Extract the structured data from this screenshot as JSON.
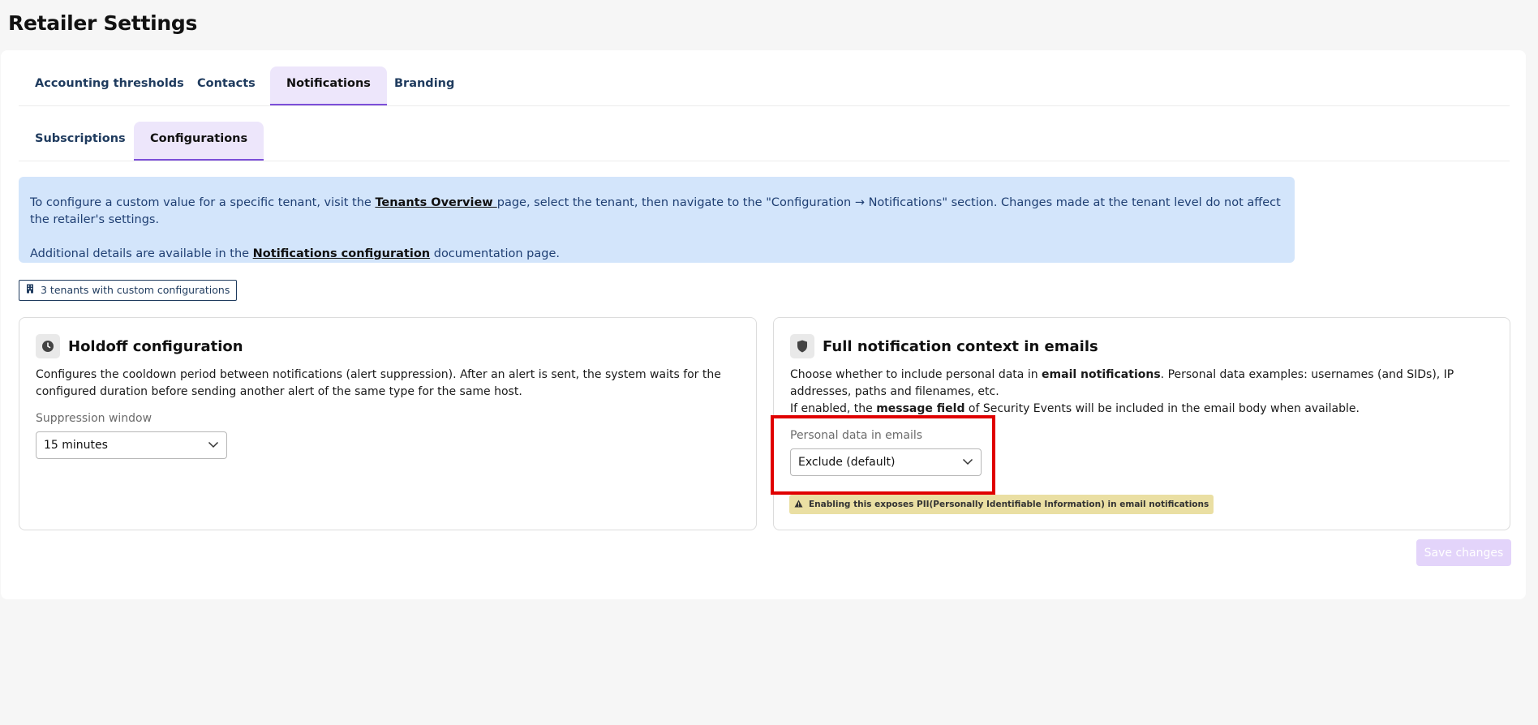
{
  "page": {
    "title": "Retailer Settings"
  },
  "main_tabs": [
    {
      "label": "Accounting thresholds",
      "active": false
    },
    {
      "label": "Contacts",
      "active": false
    },
    {
      "label": "Notifications",
      "active": true
    },
    {
      "label": "Branding",
      "active": false
    }
  ],
  "sub_tabs": [
    {
      "label": "Subscriptions",
      "active": false
    },
    {
      "label": "Configurations",
      "active": true
    }
  ],
  "info": {
    "line1_prefix": "To configure a custom value for a specific tenant, visit the ",
    "line1_link": "Tenants Overview ",
    "line1_suffix": " page, select the tenant, then navigate to the \"Configuration → Notifications\" section. Changes made at the tenant level do not affect the retailer's settings.",
    "line2_prefix": "Additional details are available in the ",
    "line2_link": "Notifications configuration",
    "line2_suffix": " documentation page."
  },
  "tenant_badge": {
    "icon": "building-icon",
    "label": "3 tenants with custom configurations"
  },
  "holdoff": {
    "icon": "clock-icon",
    "title": "Holdoff configuration",
    "description": "Configures the cooldown period between notifications (alert suppression). After an alert is sent, the system waits for the configured duration before sending another alert of the same type for the same host.",
    "field_label": "Suppression window",
    "selected": "15 minutes"
  },
  "full_context": {
    "icon": "shield-icon",
    "title": "Full notification context in emails",
    "desc_1": "Choose whether to include personal data in ",
    "desc_bold_1": "email notifications",
    "desc_2": ". Personal data examples: usernames (and SIDs), IP addresses, paths and filenames, etc.",
    "desc_3": "If enabled, the ",
    "desc_bold_2": "message field",
    "desc_4": " of Security Events will be included in the email body when available.",
    "field_label": "Personal data in emails",
    "selected": "Exclude (default)",
    "warning": "Enabling this exposes PII(Personally Identifiable Information) in email notifications"
  },
  "actions": {
    "save_label": "Save changes",
    "save_enabled": false
  },
  "colors": {
    "accent": "#7c4ed8",
    "highlight": "#e00000",
    "info_bg": "#d3e5fb",
    "warning_bg": "#eadfa3"
  }
}
